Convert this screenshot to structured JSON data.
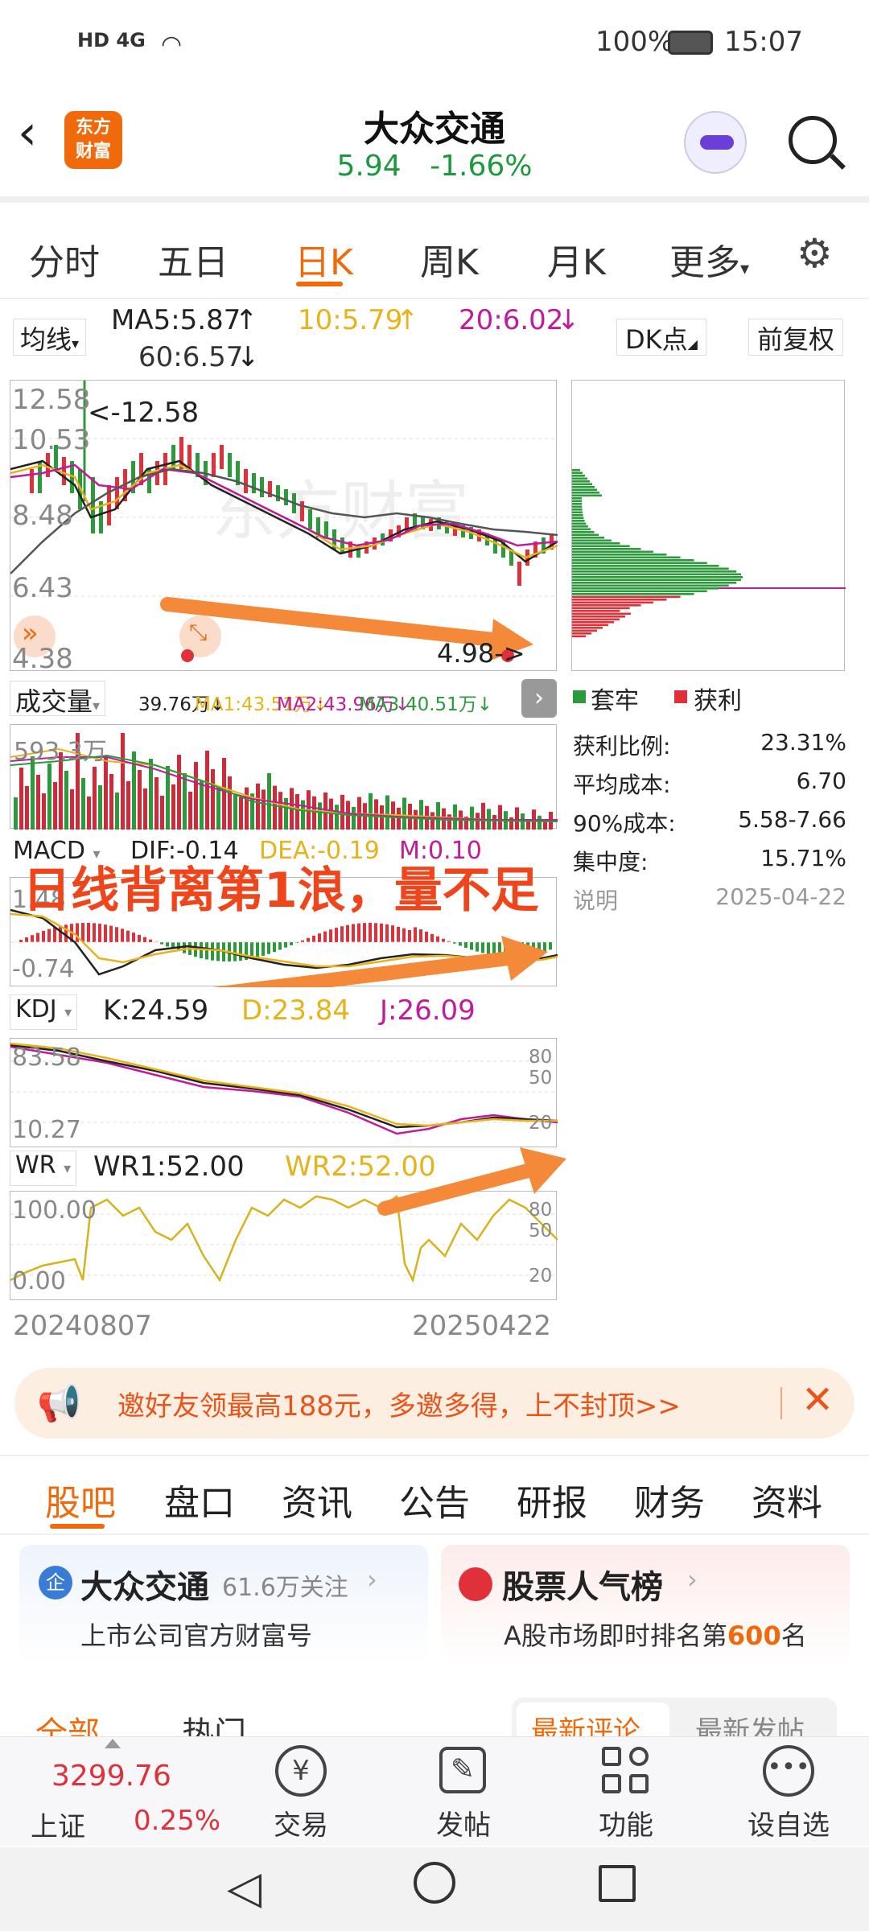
{
  "status_bar": {
    "network": "HD 4G",
    "battery": "100%",
    "time": "15:07"
  },
  "header": {
    "logo_text_1": "东方",
    "logo_text_2": "财富",
    "stock_name": "大众交通",
    "price": "5.94",
    "change_pct": "-1.66%"
  },
  "period_tabs": [
    "分时",
    "五日",
    "日K",
    "周K",
    "月K",
    "更多"
  ],
  "active_period": "日K",
  "indicator_bar": {
    "selector": "均线",
    "ma5": "MA5:5.87",
    "ma10": "10:5.79",
    "ma20": "20:6.02",
    "ma60": "60:6.57",
    "dk_button": "DK点",
    "adjust_button": "前复权"
  },
  "price_chart": {
    "y_ticks": [
      "12.58",
      "10.53",
      "8.48",
      "6.43",
      "4.38"
    ],
    "high_marker": "<-12.58",
    "low_marker": "4.98->"
  },
  "volume_bar": {
    "selector": "成交量",
    "vol": "39.76万↓",
    "ma1": "MA1:43.51万↓",
    "ma2": "MA2:43.96万↓",
    "ma3": "MA3:40.51万↓",
    "y_tick": "593.3万"
  },
  "macd_bar": {
    "selector": "MACD",
    "dif": "DIF:-0.14",
    "dea": "DEA:-0.19",
    "m": "M:0.10",
    "y_ticks": [
      "1.48",
      "-0.74"
    ]
  },
  "kdj_bar": {
    "selector": "KDJ",
    "k": "K:24.59",
    "d": "D:23.84",
    "j": "J:26.09",
    "y_ticks": [
      "83.58",
      "10.27"
    ],
    "right_ticks": [
      "80",
      "50",
      "20"
    ]
  },
  "wr_bar": {
    "selector": "WR",
    "wr1": "WR1:52.00",
    "wr2": "WR2:52.00",
    "y_ticks": [
      "100.00",
      "0.00"
    ],
    "right_ticks": [
      "80",
      "50",
      "20"
    ]
  },
  "date_axis": {
    "start": "20240807",
    "end": "20250422"
  },
  "annotation_text": "日线背离第1浪，量不足",
  "chip_distribution": {
    "legend_trapped": "套牢",
    "legend_profit": "获利",
    "rows": [
      {
        "label": "获利比例:",
        "value": "23.31%"
      },
      {
        "label": "平均成本:",
        "value": "6.70"
      },
      {
        "label": "90%成本:",
        "value": "5.58-7.66"
      },
      {
        "label": "集中度:",
        "value": "15.71%"
      }
    ],
    "note_label": "说明",
    "date": "2025-04-22"
  },
  "promo_banner": {
    "text": "邀好友领最高188元，多邀多得，上不封顶>>"
  },
  "content_tabs": [
    "股吧",
    "盘口",
    "资讯",
    "公告",
    "研报",
    "财务",
    "资料"
  ],
  "active_content_tab": "股吧",
  "cards": {
    "left": {
      "badge": "企",
      "title": "大众交通",
      "followers": "61.6万关注",
      "subtitle": "上市公司官方财富号"
    },
    "right": {
      "title": "股票人气榜",
      "subtitle_prefix": "A股市场即时排名第",
      "rank": "600",
      "subtitle_suffix": "名"
    }
  },
  "feed_tabs": {
    "all": "全部",
    "hot": "热门",
    "latest_comment": "最新评论",
    "latest_post": "最新发帖"
  },
  "bottom_nav": {
    "index_value": "3299.76",
    "index_name": "上证",
    "index_change": "0.25%",
    "trade": "交易",
    "post": "发帖",
    "functions": "功能",
    "watchlist": "设自选"
  },
  "colors": {
    "accent": "#f06a0c",
    "up": "#e0303a",
    "down": "#2a9a3a"
  }
}
